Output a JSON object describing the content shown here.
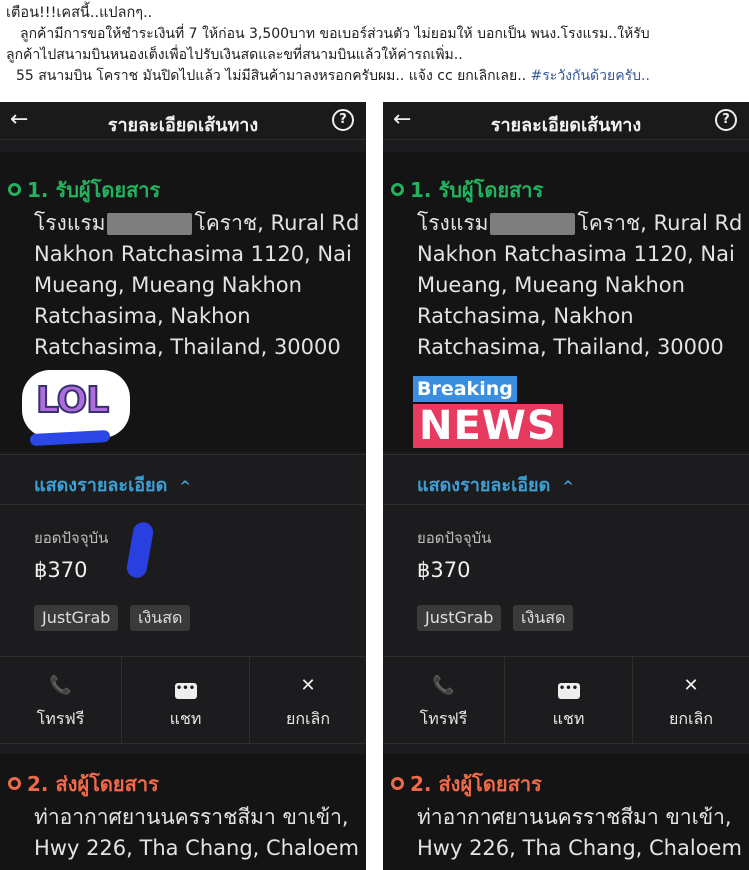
{
  "post": {
    "line1": "เตือน!!!เคสนี้..แปลกๆ..",
    "line2": "ลูกค้ามีการขอให้ชำระเงินที่ 7 ให้ก่อน 3,500บาท ขอเบอร์ส่วนตัว ไม่ยอมให้ บอกเป็น พนง.โรงแรม..ให้รับ",
    "line3": "ลูกค้าไปสนามบินหนองเต็งเพื่อไปรับเงินสดและขที่สนามบินแล้วให้ค่ารถเพิ่ม..",
    "line4": "55 สนามบิน โคราช มันปิดไปแล้ว ไม่มีสินค้ามาลงหรอกครับผม.. แจ้ง cc ยกเลิกเลย..",
    "hashtag": "#ระวังกันด้วยครับ.."
  },
  "screen": {
    "back_icon": "←",
    "title": "รายละเอียดเส้นทาง",
    "help_icon": "?",
    "pickup_label": "1. รับผู้โดยสาร",
    "pickup_address_prefix": "โรงแรม",
    "pickup_address_suffix": "โคราช, Rural Rd Nakhon Ratchasima 1120, Nai Mueang, Mueang Nakhon Ratchasima, Nakhon Ratchasima, Thailand, 30000",
    "details_link": "แสดงรายละเอียด",
    "chevron_up": "^",
    "fare_label": "ยอดปัจจุบัน",
    "fare_value": "฿370",
    "chip_service": "JustGrab",
    "chip_payment": "เงินสด",
    "call_icon": "📞",
    "call_label": "โทรฟรี",
    "chat_icon": "•••",
    "chat_label": "แชท",
    "cancel_icon": "✕",
    "cancel_label": "ยกเลิก",
    "dropoff_label": "2. ส่งผู้โดยสาร",
    "dropoff_address": "ท่าอากาศยานนครราชสีมา ขาเข้า, Hwy 226, Tha Chang, Chaloem"
  },
  "stickers": {
    "lol": "LOL",
    "breaking": "Breaking",
    "news": "NEWS"
  },
  "colors": {
    "background": "#1c1c1e",
    "pickup_green": "#23b35f",
    "dropoff_red": "#ee6a4a",
    "link_blue": "#3d9fd3",
    "hashtag_blue": "#385898"
  }
}
